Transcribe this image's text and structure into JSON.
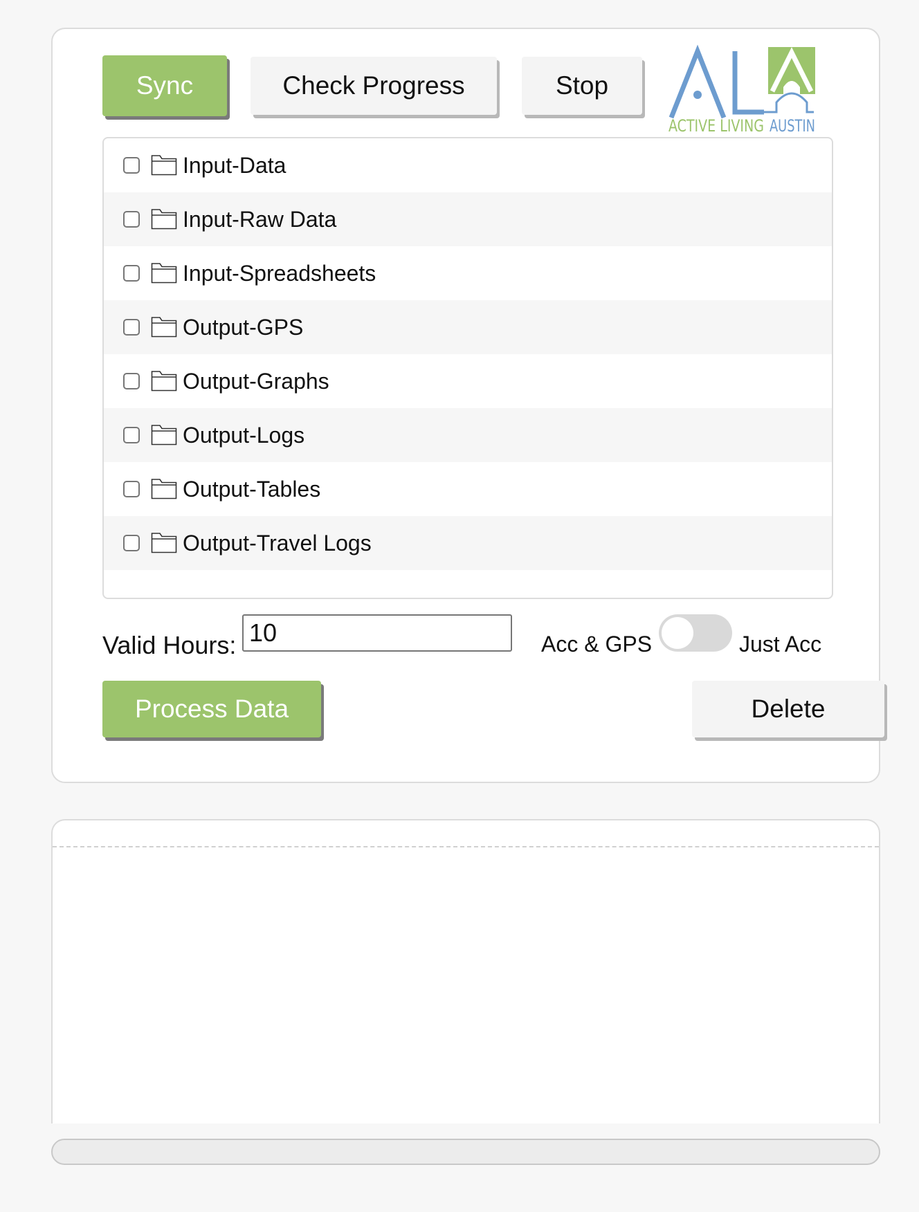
{
  "toolbar": {
    "sync_label": "Sync",
    "check_progress_label": "Check Progress",
    "stop_label": "Stop"
  },
  "logo": {
    "letters": "ALA",
    "tagline_left": "ACTIVE LIVING",
    "tagline_right": "AUSTIN",
    "colors": {
      "blue": "#6d9ccf",
      "green": "#9cc46c"
    }
  },
  "folders": [
    {
      "name": "Input-Data",
      "checked": false
    },
    {
      "name": "Input-Raw Data",
      "checked": false
    },
    {
      "name": "Input-Spreadsheets",
      "checked": false
    },
    {
      "name": "Output-GPS",
      "checked": false
    },
    {
      "name": "Output-Graphs",
      "checked": false
    },
    {
      "name": "Output-Logs",
      "checked": false
    },
    {
      "name": "Output-Tables",
      "checked": false
    },
    {
      "name": "Output-Travel Logs",
      "checked": false
    }
  ],
  "valid_hours": {
    "label": "Valid Hours:",
    "value": "10"
  },
  "mode_toggle": {
    "left_label": "Acc & GPS",
    "right_label": "Just Acc",
    "state": "Acc & GPS"
  },
  "actions": {
    "process_label": "Process Data",
    "delete_label": "Delete"
  },
  "colors": {
    "accent_green": "#9cc46c",
    "panel_border": "#dcdcdc"
  },
  "progress": {
    "fraction": 0
  }
}
